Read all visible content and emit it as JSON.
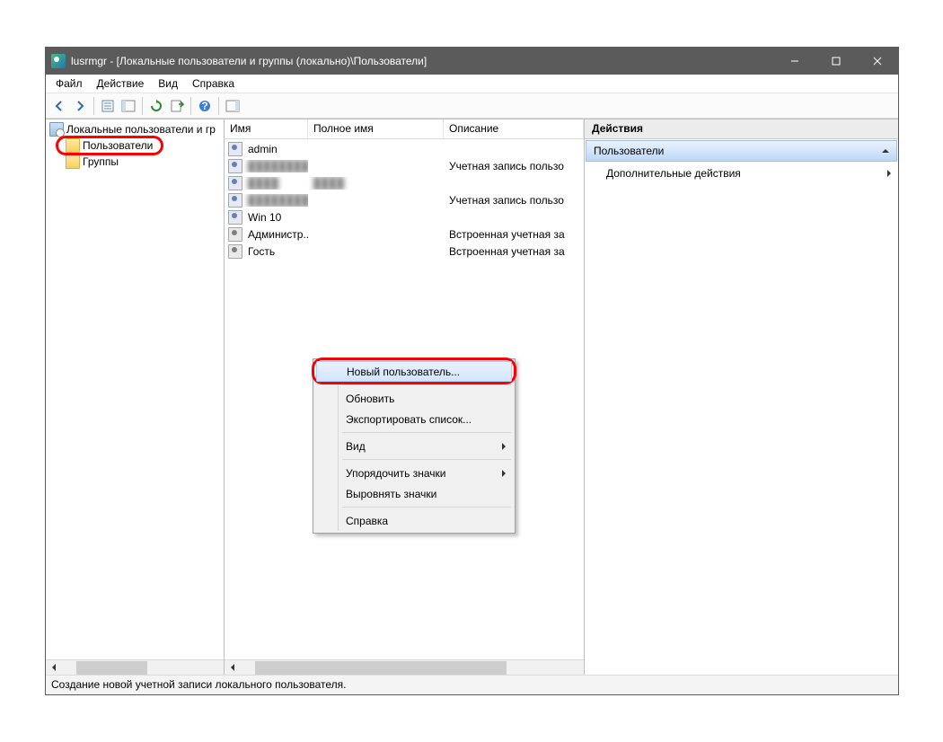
{
  "title": "lusrmgr - [Локальные пользователи и группы (локально)\\Пользователи]",
  "menu": {
    "file": "Файл",
    "action": "Действие",
    "view": "Вид",
    "help": "Справка"
  },
  "tree": {
    "root": "Локальные пользователи и гр",
    "users": "Пользователи",
    "groups": "Группы"
  },
  "columns": {
    "name": "Имя",
    "fullname": "Полное имя",
    "description": "Описание"
  },
  "users": [
    {
      "name": "admin",
      "fullname": "",
      "description": "",
      "disabled": false,
      "blur": false
    },
    {
      "name": "████████",
      "fullname": "",
      "description": "Учетная запись пользо",
      "disabled": false,
      "blur": true
    },
    {
      "name": "████",
      "fullname": "████",
      "description": "",
      "disabled": false,
      "blur": true
    },
    {
      "name": "████████████",
      "fullname": "",
      "description": "Учетная запись пользо",
      "disabled": false,
      "blur": true
    },
    {
      "name": "Win 10",
      "fullname": "",
      "description": "",
      "disabled": false,
      "blur": false
    },
    {
      "name": "Администр...",
      "fullname": "",
      "description": "Встроенная учетная за",
      "disabled": true,
      "blur": false
    },
    {
      "name": "Гость",
      "fullname": "",
      "description": "Встроенная учетная за",
      "disabled": true,
      "blur": false
    }
  ],
  "context_menu": {
    "new_user": "Новый пользователь...",
    "refresh": "Обновить",
    "export": "Экспортировать список...",
    "view": "Вид",
    "arrange": "Упорядочить значки",
    "align": "Выровнять значки",
    "help": "Справка"
  },
  "actions": {
    "header": "Действия",
    "sub": "Пользователи",
    "more": "Дополнительные действия"
  },
  "status": "Создание новой учетной записи локального пользователя.",
  "col_widths": {
    "name": 93,
    "fullname": 151,
    "description": 134
  }
}
